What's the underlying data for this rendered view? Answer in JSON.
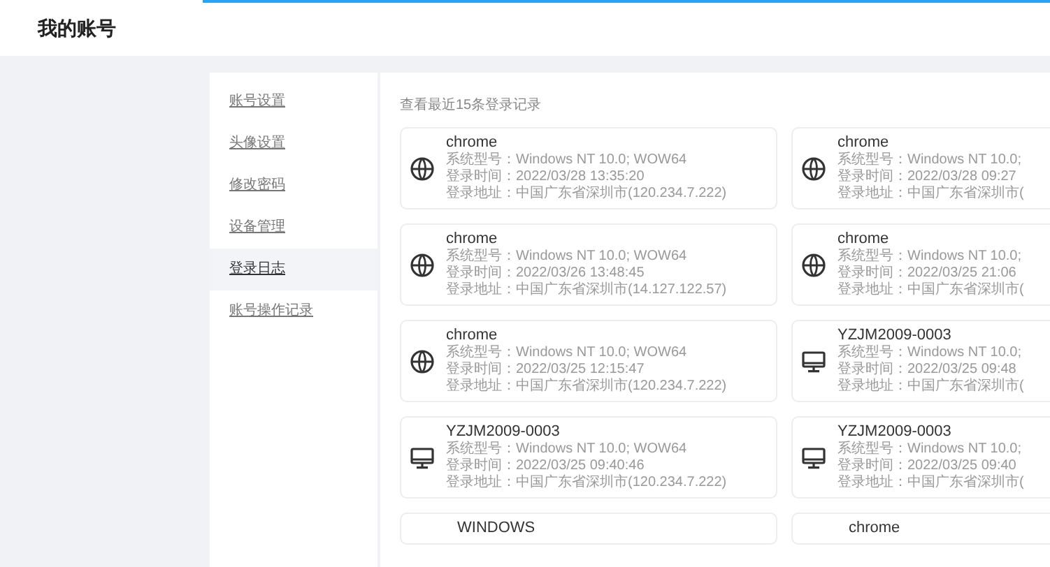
{
  "header": {
    "title": "我的账号"
  },
  "sidebar": {
    "items": [
      {
        "label": "账号设置",
        "selected": false
      },
      {
        "label": "头像设置",
        "selected": false
      },
      {
        "label": "修改密码",
        "selected": false
      },
      {
        "label": "设备管理",
        "selected": false
      },
      {
        "label": "登录日志",
        "selected": true
      },
      {
        "label": "账号操作记录",
        "selected": false
      }
    ]
  },
  "content": {
    "caption": "查看最近15条登录记录",
    "records": [
      {
        "kind": "browser",
        "name": "chrome",
        "os": "系统型号：Windows NT 10.0; WOW64",
        "time": "登录时间：2022/03/28 13:35:20",
        "address": "登录地址：中国广东省深圳市(120.234.7.222)"
      },
      {
        "kind": "browser",
        "name": "chrome",
        "os": "系统型号：Windows NT 10.0;",
        "time": "登录时间：2022/03/28 09:27",
        "address": "登录地址：中国广东省深圳市("
      },
      {
        "kind": "browser",
        "name": "chrome",
        "os": "系统型号：Windows NT 10.0; WOW64",
        "time": "登录时间：2022/03/26 13:48:45",
        "address": "登录地址：中国广东省深圳市(14.127.122.57)"
      },
      {
        "kind": "browser",
        "name": "chrome",
        "os": "系统型号：Windows NT 10.0;",
        "time": "登录时间：2022/03/25 21:06",
        "address": "登录地址：中国广东省深圳市("
      },
      {
        "kind": "browser",
        "name": "chrome",
        "os": "系统型号：Windows NT 10.0; WOW64",
        "time": "登录时间：2022/03/25 12:15:47",
        "address": "登录地址：中国广东省深圳市(120.234.7.222)"
      },
      {
        "kind": "desktop",
        "name": "YZJM2009-0003",
        "os": "系统型号：Windows NT 10.0;",
        "time": "登录时间：2022/03/25 09:48",
        "address": "登录地址：中国广东省深圳市("
      },
      {
        "kind": "desktop",
        "name": "YZJM2009-0003",
        "os": "系统型号：Windows NT 10.0; WOW64",
        "time": "登录时间：2022/03/25 09:40:46",
        "address": "登录地址：中国广东省深圳市(120.234.7.222)"
      },
      {
        "kind": "desktop",
        "name": "YZJM2009-0003",
        "os": "系统型号：Windows NT 10.0;",
        "time": "登录时间：2022/03/25 09:40",
        "address": "登录地址：中国广东省深圳市("
      },
      {
        "kind": "partial",
        "name": "WINDOWS"
      },
      {
        "kind": "partial",
        "name": "chrome"
      }
    ]
  }
}
